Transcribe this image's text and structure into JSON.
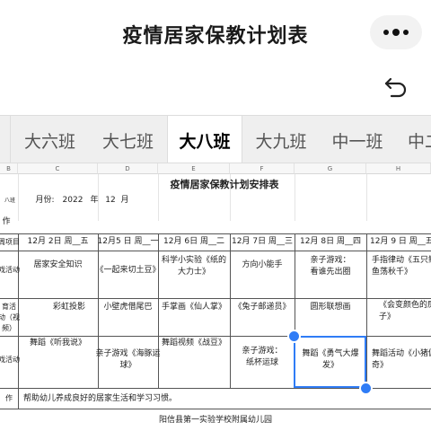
{
  "header": {
    "title": "疫情居家保教计划表",
    "more_icon": "more-dots-icon",
    "undo_icon": "undo-icon"
  },
  "tabs": [
    {
      "label": "大六班",
      "active": false
    },
    {
      "label": "大七班",
      "active": false
    },
    {
      "label": "大八班",
      "active": true
    },
    {
      "label": "大九班",
      "active": false
    },
    {
      "label": "中一班",
      "active": false
    },
    {
      "label": "中二",
      "active": false
    }
  ],
  "sheet": {
    "columns": [
      "B",
      "C",
      "D",
      "E",
      "F",
      "G",
      "H"
    ],
    "title": "疫情居家保教计划安排表",
    "class_label": "八班",
    "month": {
      "label": "月份:",
      "year": "2022",
      "year_unit": "年",
      "month": "12",
      "month_unit": "月"
    },
    "left_labels": {
      "r1": "作",
      "r2": "周项目",
      "r3": "戏活动",
      "r4a": "育活",
      "r4b": "动（视",
      "r4c": "频）",
      "r5": "戏活动",
      "r6": "作"
    },
    "days": [
      "12月 2日 周__五",
      "12月5 日 周__一",
      "12月 6日 周__二",
      "12月 7日 周__三",
      "12月 8日 周__四",
      "12月 9 日 周__五"
    ],
    "row_game": [
      "居家安全知识",
      "《一起来切土豆》",
      "科学小实验《纸的\n大力士》",
      "方向小能手",
      "亲子游戏：\n看谁先出圈",
      "手指律动《五只鲜\n鱼荡秋千》"
    ],
    "row_edu": [
      "彩虹投影",
      "小壁虎借尾巴",
      "手掌画《仙人掌》",
      "《兔子邮递员》",
      "圆形联想画",
      "《会变颜色的房\n子》"
    ],
    "row_play_top": [
      "舞蹈《听我说》",
      "",
      "舞蹈视频《战豆》",
      "",
      "",
      ""
    ],
    "row_play_bottom": [
      "",
      "亲子游戏《海豚运\n球》",
      "",
      "亲子游戏：\n纸杯运球",
      "舞蹈《勇气大爆\n发》",
      "舞蹈活动《小猪佩\n奇》"
    ],
    "note": "帮助幼儿养成良好的居家生活和学习习惯。",
    "footer": "阳信县第一实验学校附属幼儿园"
  }
}
